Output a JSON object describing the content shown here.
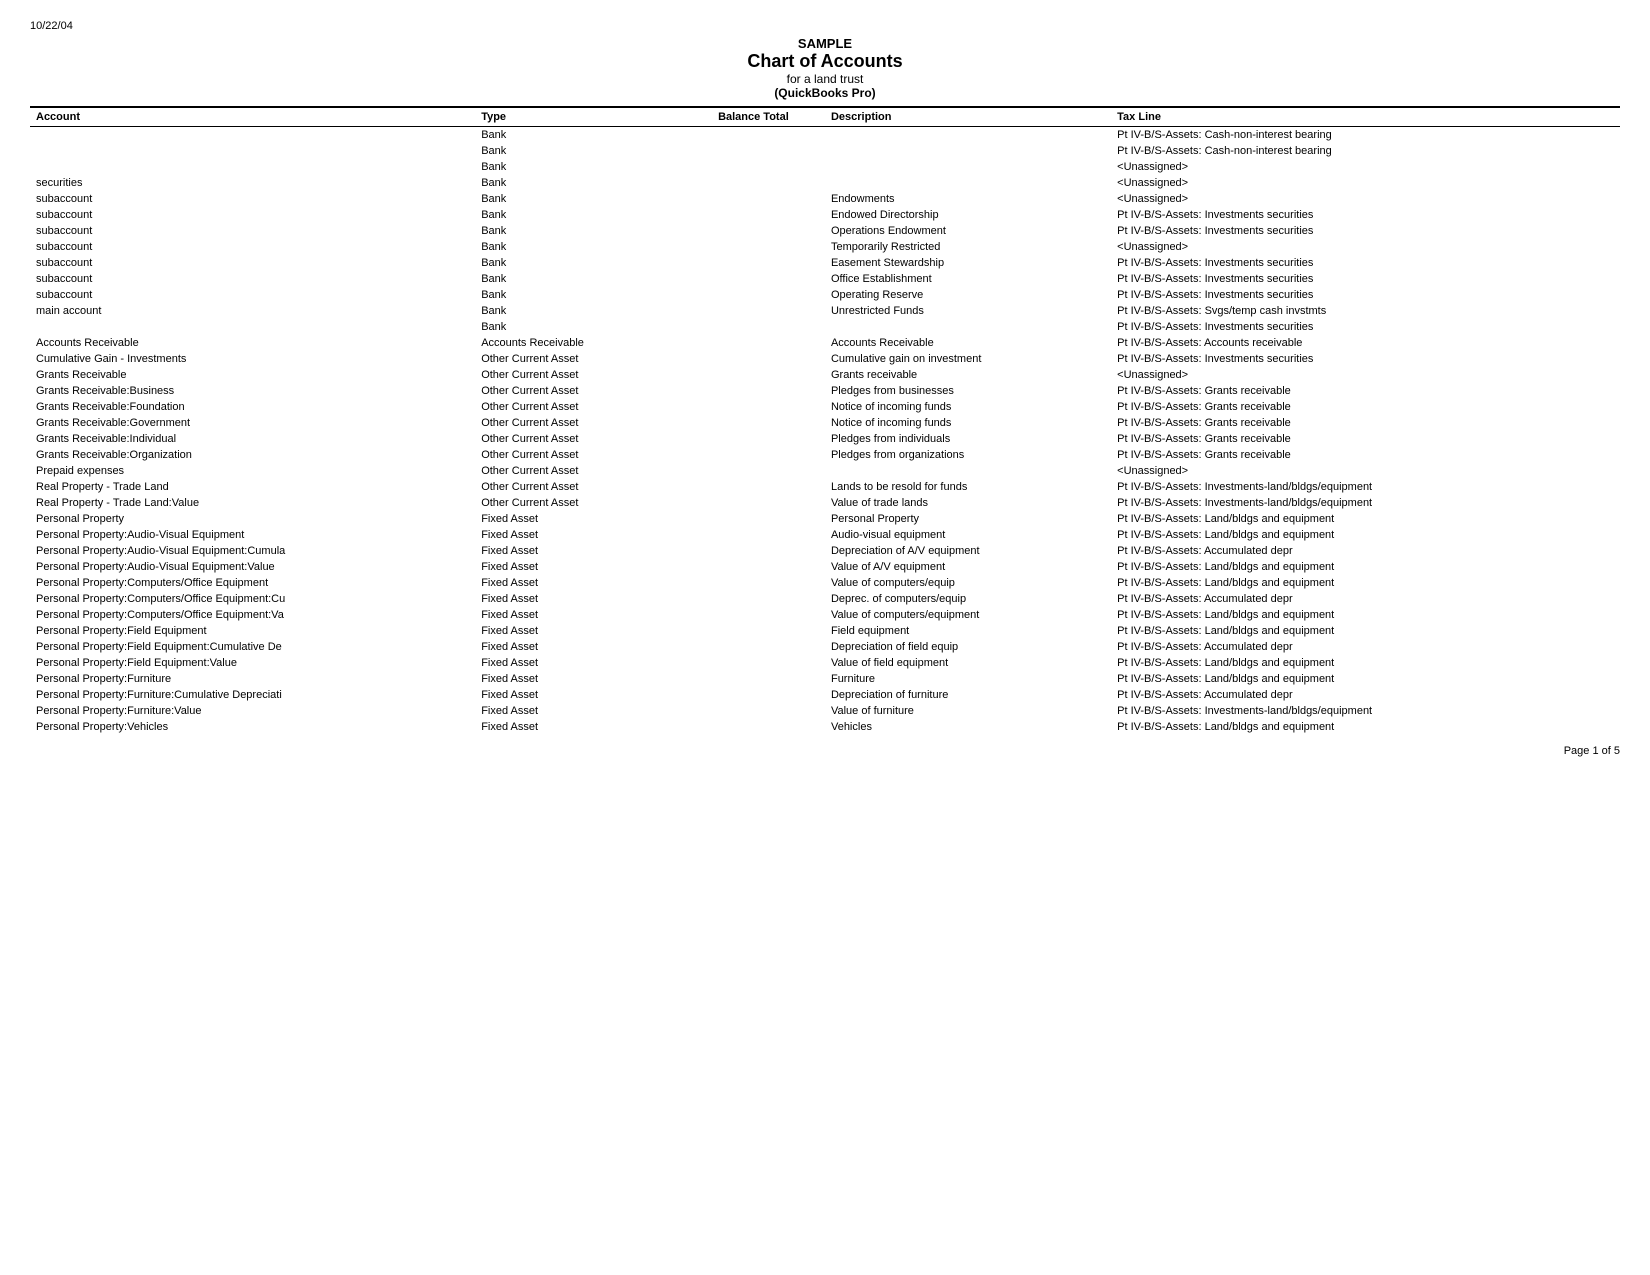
{
  "date": "10/22/04",
  "header": {
    "sample": "SAMPLE",
    "title": "Chart of Accounts",
    "subtitle": "for a land trust",
    "subtitle2": "(QuickBooks Pro)"
  },
  "columns": {
    "account": "Account",
    "type": "Type",
    "balance_total": "Balance Total",
    "description": "Description",
    "tax_line": "Tax Line"
  },
  "rows": [
    {
      "account": "",
      "type": "Bank",
      "balance": "",
      "description": "",
      "tax_line": "Pt IV-B/S-Assets: Cash-non-interest bearing"
    },
    {
      "account": "",
      "type": "Bank",
      "balance": "",
      "description": "",
      "tax_line": "Pt IV-B/S-Assets: Cash-non-interest bearing"
    },
    {
      "account": "",
      "type": "Bank",
      "balance": "",
      "description": "",
      "tax_line": "<Unassigned>"
    },
    {
      "account": "securities",
      "type": "Bank",
      "balance": "",
      "description": "",
      "tax_line": "<Unassigned>"
    },
    {
      "account": "subaccount",
      "type": "Bank",
      "balance": "",
      "description": "Endowments",
      "tax_line": "<Unassigned>"
    },
    {
      "account": "subaccount",
      "type": "Bank",
      "balance": "",
      "description": "Endowed Directorship",
      "tax_line": "Pt IV-B/S-Assets: Investments securities"
    },
    {
      "account": "subaccount",
      "type": "Bank",
      "balance": "",
      "description": "Operations Endowment",
      "tax_line": "Pt IV-B/S-Assets: Investments securities"
    },
    {
      "account": "subaccount",
      "type": "Bank",
      "balance": "",
      "description": "Temporarily Restricted",
      "tax_line": "<Unassigned>"
    },
    {
      "account": "subaccount",
      "type": "Bank",
      "balance": "",
      "description": "Easement Stewardship",
      "tax_line": "Pt IV-B/S-Assets: Investments securities"
    },
    {
      "account": "subaccount",
      "type": "Bank",
      "balance": "",
      "description": "Office Establishment",
      "tax_line": "Pt IV-B/S-Assets: Investments securities"
    },
    {
      "account": "subaccount",
      "type": "Bank",
      "balance": "",
      "description": "Operating Reserve",
      "tax_line": "Pt IV-B/S-Assets: Investments securities"
    },
    {
      "account": "main account",
      "type": "Bank",
      "balance": "",
      "description": "Unrestricted Funds",
      "tax_line": "Pt IV-B/S-Assets: Svgs/temp cash invstmts"
    },
    {
      "account": "",
      "type": "Bank",
      "balance": "",
      "description": "",
      "tax_line": "Pt IV-B/S-Assets: Investments securities"
    },
    {
      "account": "Accounts Receivable",
      "type": "Accounts Receivable",
      "balance": "",
      "description": "Accounts Receivable",
      "tax_line": "Pt IV-B/S-Assets: Accounts receivable"
    },
    {
      "account": "Cumulative Gain - Investments",
      "type": "Other Current Asset",
      "balance": "",
      "description": "Cumulative gain on investment",
      "tax_line": "Pt IV-B/S-Assets: Investments securities"
    },
    {
      "account": "Grants Receivable",
      "type": "Other Current Asset",
      "balance": "",
      "description": "Grants receivable",
      "tax_line": "<Unassigned>"
    },
    {
      "account": "Grants Receivable:Business",
      "type": "Other Current Asset",
      "balance": "",
      "description": "Pledges from businesses",
      "tax_line": "Pt IV-B/S-Assets: Grants receivable"
    },
    {
      "account": "Grants Receivable:Foundation",
      "type": "Other Current Asset",
      "balance": "",
      "description": "Notice of incoming funds",
      "tax_line": "Pt IV-B/S-Assets: Grants receivable"
    },
    {
      "account": "Grants Receivable:Government",
      "type": "Other Current Asset",
      "balance": "",
      "description": "Notice of incoming funds",
      "tax_line": "Pt IV-B/S-Assets: Grants receivable"
    },
    {
      "account": "Grants Receivable:Individual",
      "type": "Other Current Asset",
      "balance": "",
      "description": "Pledges from individuals",
      "tax_line": "Pt IV-B/S-Assets: Grants receivable"
    },
    {
      "account": "Grants Receivable:Organization",
      "type": "Other Current Asset",
      "balance": "",
      "description": "Pledges from organizations",
      "tax_line": "Pt IV-B/S-Assets: Grants receivable"
    },
    {
      "account": "Prepaid expenses",
      "type": "Other Current Asset",
      "balance": "",
      "description": "",
      "tax_line": "<Unassigned>"
    },
    {
      "account": "Real Property - Trade Land",
      "type": "Other Current Asset",
      "balance": "",
      "description": "Lands to be resold for funds",
      "tax_line": "Pt IV-B/S-Assets: Investments-land/bldgs/equipment"
    },
    {
      "account": "Real Property - Trade Land:Value",
      "type": "Other Current Asset",
      "balance": "",
      "description": "Value of trade lands",
      "tax_line": "Pt IV-B/S-Assets: Investments-land/bldgs/equipment"
    },
    {
      "account": "Personal Property",
      "type": "Fixed Asset",
      "balance": "",
      "description": "Personal Property",
      "tax_line": "Pt IV-B/S-Assets: Land/bldgs and equipment"
    },
    {
      "account": "Personal Property:Audio-Visual Equipment",
      "type": "Fixed Asset",
      "balance": "",
      "description": "Audio-visual equipment",
      "tax_line": "Pt IV-B/S-Assets: Land/bldgs and equipment"
    },
    {
      "account": "Personal Property:Audio-Visual Equipment:Cumula Fixed Asset",
      "type": "",
      "balance": "",
      "description": "Depreciation of A/V equipment",
      "tax_line": "Pt IV-B/S-Assets: Accumulated depr"
    },
    {
      "account": "Personal Property:Audio-Visual Equipment:Value  Fixed Asset",
      "type": "",
      "balance": "",
      "description": "Value of A/V equipment",
      "tax_line": "Pt IV-B/S-Assets: Land/bldgs and equipment"
    },
    {
      "account": "Personal Property:Computers/Office Equipment",
      "type": "Fixed Asset",
      "balance": "",
      "description": "Value of computers/equip",
      "tax_line": "Pt IV-B/S-Assets: Land/bldgs and equipment"
    },
    {
      "account": "Personal Property:Computers/Office Equipment:Cu Fixed Asset",
      "type": "",
      "balance": "",
      "description": "Deprec. of computers/equip",
      "tax_line": "Pt IV-B/S-Assets: Accumulated depr"
    },
    {
      "account": "Personal Property:Computers/Office Equipment:Va Fixed Asset",
      "type": "",
      "balance": "",
      "description": "Value of computers/equipment",
      "tax_line": "Pt IV-B/S-Assets: Land/bldgs and equipment"
    },
    {
      "account": "Personal Property:Field Equipment",
      "type": "Fixed Asset",
      "balance": "",
      "description": "Field equipment",
      "tax_line": "Pt IV-B/S-Assets: Land/bldgs and equipment"
    },
    {
      "account": "Personal Property:Field Equipment:Cumulative De Fixed Asset",
      "type": "",
      "balance": "",
      "description": "Depreciation of field equip",
      "tax_line": "Pt IV-B/S-Assets: Accumulated depr"
    },
    {
      "account": "Personal Property:Field Equipment:Value",
      "type": "Fixed Asset",
      "balance": "",
      "description": "Value of field equipment",
      "tax_line": "Pt IV-B/S-Assets: Land/bldgs and equipment"
    },
    {
      "account": "Personal Property:Furniture",
      "type": "Fixed Asset",
      "balance": "",
      "description": "Furniture",
      "tax_line": "Pt IV-B/S-Assets: Land/bldgs and equipment"
    },
    {
      "account": "Personal Property:Furniture:Cumulative Depreciati Fixed Asset",
      "type": "",
      "balance": "",
      "description": "Depreciation of furniture",
      "tax_line": "Pt IV-B/S-Assets: Accumulated depr"
    },
    {
      "account": "Personal Property:Furniture:Value",
      "type": "Fixed Asset",
      "balance": "",
      "description": "Value of furniture",
      "tax_line": "Pt IV-B/S-Assets: Investments-land/bldgs/equipment"
    },
    {
      "account": "Personal Property:Vehicles",
      "type": "Fixed Asset",
      "balance": "",
      "description": "Vehicles",
      "tax_line": "Pt IV-B/S-Assets: Land/bldgs and equipment"
    }
  ],
  "page": "Page 1 of 5"
}
